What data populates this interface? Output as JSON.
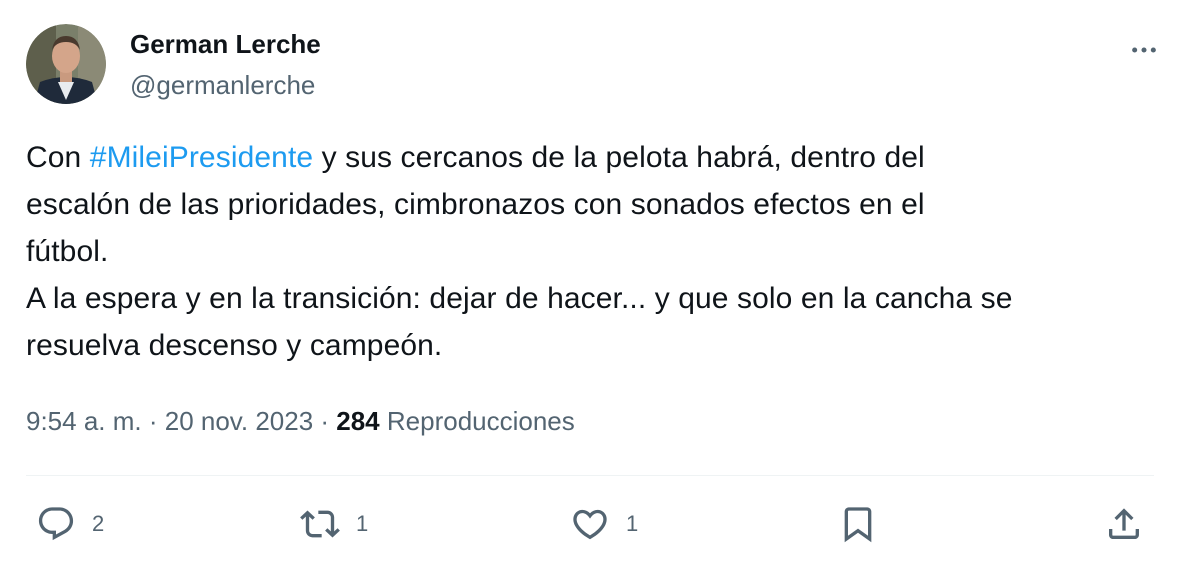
{
  "tweet": {
    "author": {
      "display_name": "German Lerche",
      "handle": "@germanlerche"
    },
    "text": {
      "prefix": "Con ",
      "hashtag": "#MileiPresidente",
      "line1_rest": " y sus cercanos de la pelota habrá, dentro del",
      "line2": "escalón de las prioridades, cimbronazos con sonados efectos en el",
      "line3": "fútbol.",
      "line4": "A la espera y en la transición: dejar de hacer... y que solo en la cancha se",
      "line5": "resuelva descenso y campeón."
    },
    "meta": {
      "time": "9:54 a. m.",
      "separator": " · ",
      "date": "20 nov. 2023",
      "views_count": "284",
      "views_label": " Reproducciones"
    },
    "actions": {
      "replies": "2",
      "reposts": "1",
      "likes": "1"
    }
  },
  "icons": {
    "more": "more-icon",
    "reply": "reply-icon",
    "repost": "repost-icon",
    "like": "like-icon",
    "bookmark": "bookmark-icon",
    "share": "share-icon"
  },
  "colors": {
    "text": "#0f1419",
    "secondary": "#536471",
    "link": "#1d9bf0",
    "divider": "#eff3f4"
  }
}
